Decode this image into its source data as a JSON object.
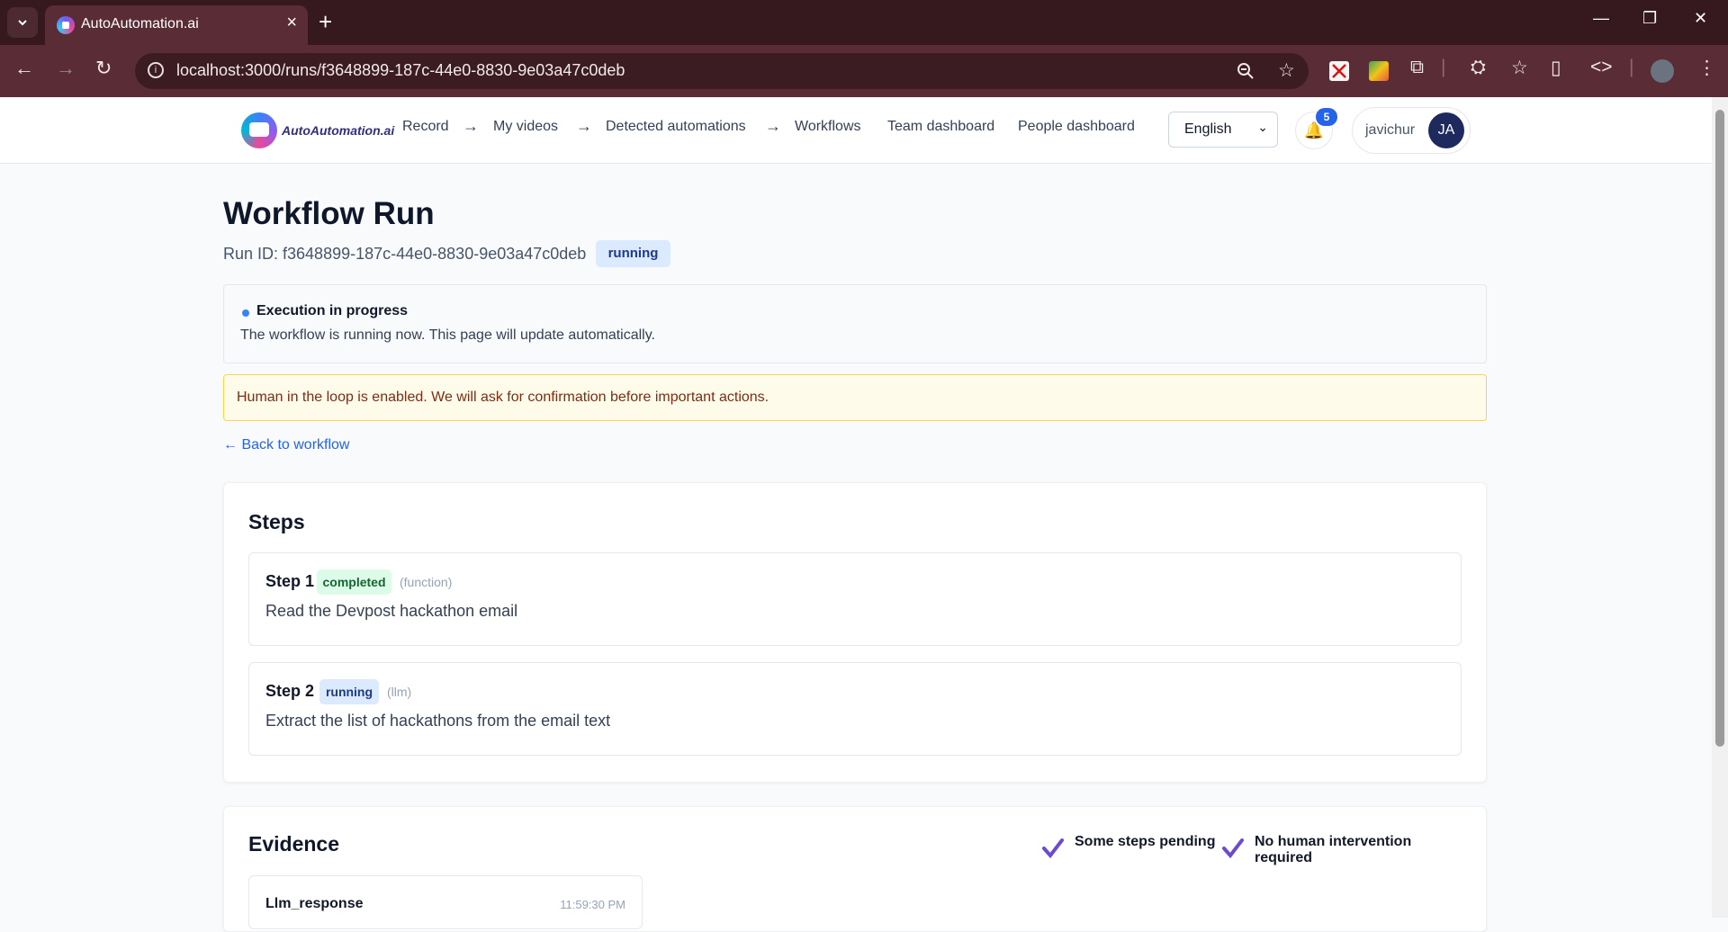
{
  "browser": {
    "tab_title": "AutoAutomation.ai",
    "url": "localhost:3000/runs/f3648899-187c-44e0-8830-9e03a47c0deb"
  },
  "header": {
    "logo_text": "AutoAutomation.ai",
    "nav": {
      "record": "Record",
      "my_videos": "My videos",
      "detected": "Detected automations",
      "workflows": "Workflows",
      "team": "Team dashboard",
      "people": "People dashboard",
      "arrow": "→"
    },
    "language": "English",
    "notification_count": "5",
    "username": "javichur",
    "avatar_initials": "JA"
  },
  "page": {
    "title": "Workflow Run",
    "run_id_label": "Run ID: f3648899-187c-44e0-8830-9e03a47c0deb",
    "status": "running",
    "execution_title": "Execution in progress",
    "execution_text": "The workflow is running now. This page will update automatically.",
    "hitl_text": "Human in the loop is enabled. We will ask for confirmation before important actions.",
    "back_link": "← Back to workflow"
  },
  "steps": {
    "title": "Steps",
    "items": [
      {
        "label": "Step 1",
        "status": "completed",
        "type": "(function)",
        "description": "Read the Devpost hackathon email"
      },
      {
        "label": "Step 2",
        "status": "running",
        "type": "(llm)",
        "description": "Extract the list of hackathons from the email text"
      }
    ]
  },
  "evidence": {
    "title": "Evidence",
    "flag_1": "Some steps pending",
    "flag_2": "No human intervention required",
    "items": [
      {
        "name": "Llm_response",
        "time": "11:59:30 PM"
      }
    ]
  },
  "colors": {
    "accent": "#2563eb",
    "running_bg": "#dbeafe",
    "completed_bg": "#dcfce7",
    "check": "#6d4bd1"
  }
}
